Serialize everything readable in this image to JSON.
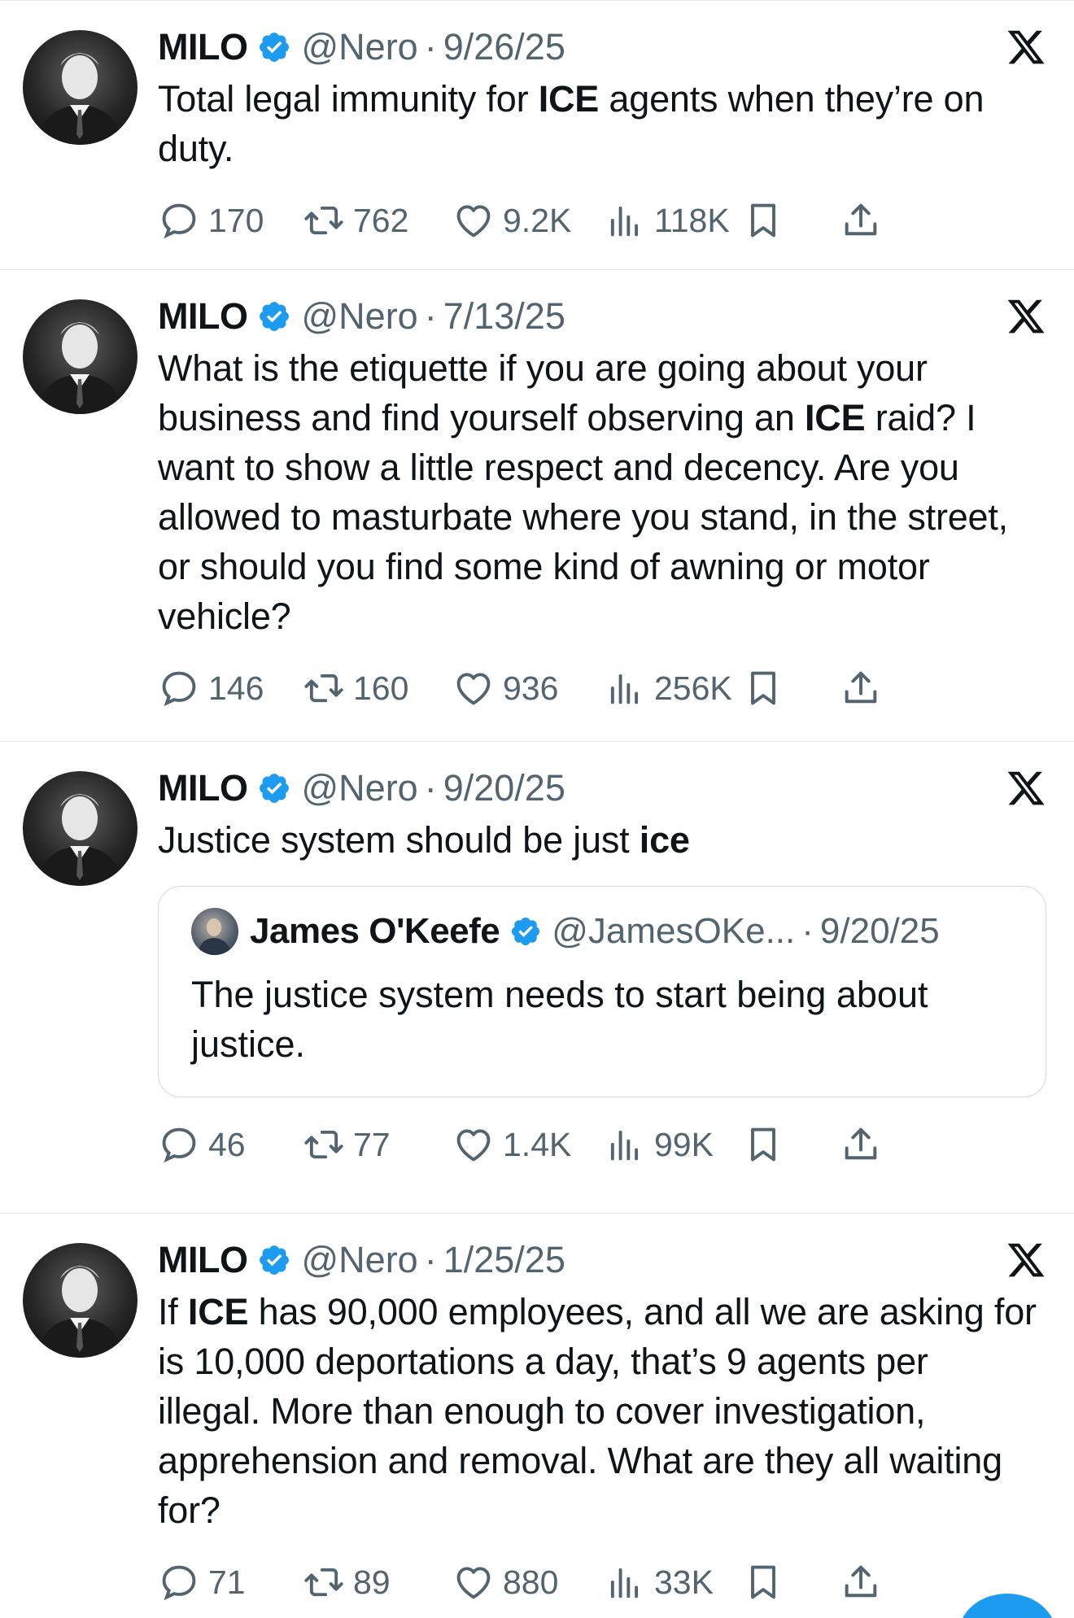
{
  "tweets": [
    {
      "name": "MILO",
      "handle": "@Nero",
      "dot": "·",
      "date": "9/26/25",
      "text_parts": [
        {
          "t": "Total legal immunity for ",
          "b": false
        },
        {
          "t": "ICE",
          "b": true
        },
        {
          "t": " agents when they’re on duty.",
          "b": false
        }
      ],
      "replies": "170",
      "reposts": "762",
      "likes": "9.2K",
      "views": "118K"
    },
    {
      "name": "MILO",
      "handle": "@Nero",
      "dot": "·",
      "date": "7/13/25",
      "text_parts": [
        {
          "t": "What is the etiquette if you are going about your business and find yourself observing an ",
          "b": false
        },
        {
          "t": "ICE",
          "b": true
        },
        {
          "t": " raid? I want to show a little respect and decency. Are you allowed to masturbate where you stand, in the street, or should you find some kind of awning or motor vehicle?",
          "b": false
        }
      ],
      "replies": "146",
      "reposts": "160",
      "likes": "936",
      "views": "256K"
    },
    {
      "name": "MILO",
      "handle": "@Nero",
      "dot": "·",
      "date": "9/20/25",
      "text_parts": [
        {
          "t": "Justice system should be just ",
          "b": false
        },
        {
          "t": "ice",
          "b": true
        }
      ],
      "quote": {
        "name": "James O'Keefe",
        "handle": "@JamesOKe...",
        "dot": "·",
        "date": "9/20/25",
        "text": "The justice system needs to start being about justice."
      },
      "replies": "46",
      "reposts": "77",
      "likes": "1.4K",
      "views": "99K"
    },
    {
      "name": "MILO",
      "handle": "@Nero",
      "dot": "·",
      "date": "1/25/25",
      "text_parts": [
        {
          "t": "If ",
          "b": false
        },
        {
          "t": "ICE",
          "b": true
        },
        {
          "t": " has 90,000 employees, and all we are asking for is 10,000 deportations a day, that’s 9 agents per illegal. More than enough to cover investigation, apprehension and removal. What are they all waiting for?",
          "b": false
        }
      ],
      "replies": "71",
      "reposts": "89",
      "likes": "880",
      "views": "33K"
    }
  ],
  "icons": {
    "verified": "verified-badge-icon",
    "x_logo": "x-logo-icon",
    "reply": "reply-bubble-icon",
    "repost": "repost-icon",
    "like": "heart-icon",
    "views": "views-bar-icon",
    "bookmark": "bookmark-icon",
    "share": "share-icon"
  },
  "colors": {
    "verified_blue": "#1d9bf0",
    "secondary_text": "#536471",
    "divider": "#e3e6e8"
  }
}
